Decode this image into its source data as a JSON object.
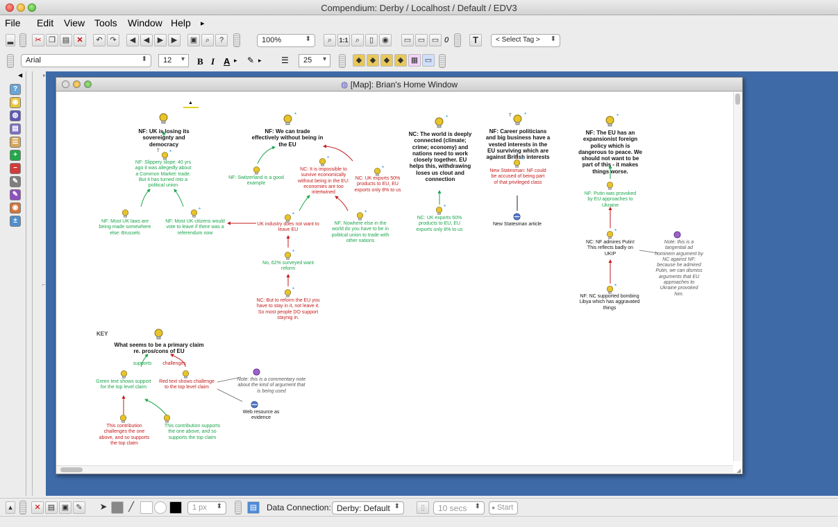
{
  "window": {
    "title": "Compendium: Derby / Localhost / Default / EDV3"
  },
  "menu": {
    "items": [
      "File",
      "Edit",
      "View",
      "Tools",
      "Window",
      "Help"
    ]
  },
  "toolbar1": {
    "zoom_value": "100%",
    "one_to_one": "1:1",
    "zero_count": "0",
    "select_tag": "< Select Tag >"
  },
  "toolbar2": {
    "font_name": "Arial",
    "font_size": "12",
    "bold": "B",
    "italic": "I",
    "text_color": "A",
    "line_width": "25"
  },
  "map_window": {
    "title": "[Map]:   Brian's Home Window"
  },
  "map": {
    "c1_title": "NF: UK is losing its sovereignty and democracy",
    "c1_sub": "NF: Slippery slope: 40 yrs ago it was allegedly about a Common Market: trade. But it has turned into a political union",
    "c1_left": "NF: Most UK laws are being made somewhere else: Brussels",
    "c1_right": "NF: Most UK citizens would vote to leave if there was a referendum now",
    "c2_title": "NF: We can trade effectively without being in the EU",
    "c2_swiss": "NF: Switzerland is a good example",
    "c2_impossible": "NC: It is impossible to survive economically without being in the EU: economies are too intertwined",
    "c2_exports": "NC: UK exports 50% products to EU, EU exports only 8% to us",
    "c2_industry": "UK industry does not want to leave EU",
    "c2_nowhere": "NF: Nowhere else in the world do you have to be in political union to trade with other nations",
    "c2_no62": "No, 62% surveyed want reform",
    "c2_reform": "NC: But to reform the EU you have to stay in it, not leave it. So most people DO support staynig in.",
    "c3_title": "NC: The world is deeply connected (climate; crime; economy) and nations need to work closely together. EU helps this, withdrawing loses us clout and connection",
    "c3_exports": "NC: UK exports 50% products to EU, EU exports only 8% to us",
    "c4_title": "NF: Career politicians and big business have a vested interests in the EU surviving which are against British interests",
    "c4_newstatesman": "New Statesman: NF could be accused of being part of that privileged class",
    "c4_article": "New Statesman article",
    "c5_title": "NF: The EU has an expansionist foreign policy which is dangerous to peace. We should not want to be part of this - it makes things worse.",
    "c5_putin": "NF: Putin was provoked by EU approaches to Ukraine",
    "c5_admires": "NC: NF admires Putin! This reflects badly on UKIP",
    "c5_note": "Note: this is a tangential ad hominem argument by NC against NF: because he admired Putin, we can dismiss arguments that EU approaches to Ukraine provoked him.",
    "c5_libya": "NF: NC supported bombing Libya which has aggravated things",
    "key_label": "KEY",
    "key_title": "What seems to be a primary claim re. pros/cons of EU",
    "key_supports": "supports",
    "key_challenges": "challenges",
    "key_green": "Green text shows support for the top level claim",
    "key_red": "Red text shows challenge to the top level claim",
    "key_note": "Note: this is a commentary note about the kind of argument that is being used",
    "key_web": "Web resource as evidence",
    "key_challenge_contrib": "This contribution challenges the one above, and so supports the top claim",
    "key_support_contrib": "This contribution supports the one above, and so supports the top claim",
    "tmark": "T"
  },
  "bottombar": {
    "line_px": "1 px",
    "data_connection_label": "Data Connection:",
    "data_connection_value": "Derby: Default",
    "interval": "10 secs",
    "start": "Start"
  },
  "colors": {
    "support": "#1aa54b",
    "challenge": "#c41a1a",
    "desktop": "#3e6ba8"
  }
}
